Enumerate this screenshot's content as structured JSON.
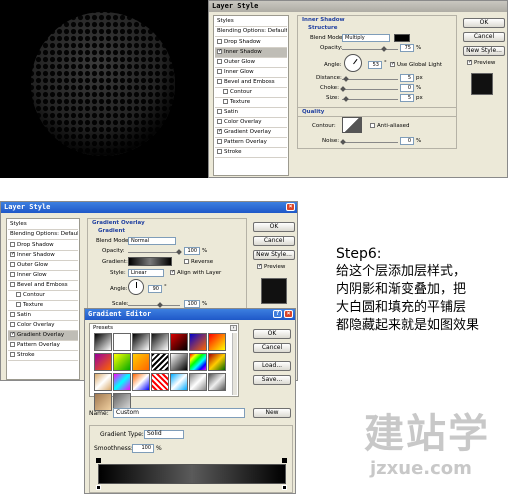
{
  "dialog1": {
    "title": "Layer Style",
    "styles_header": "Styles",
    "blending": "Blending Options: Default",
    "items": [
      "Drop Shadow",
      "Inner Shadow",
      "Outer Glow",
      "Inner Glow",
      "Bevel and Emboss",
      "Contour",
      "Texture",
      "Satin",
      "Color Overlay",
      "Gradient Overlay",
      "Pattern Overlay",
      "Stroke"
    ],
    "checked": [
      false,
      true,
      false,
      false,
      false,
      false,
      false,
      false,
      false,
      true,
      false,
      false
    ],
    "selected_index": 1,
    "group_title": "Inner Shadow",
    "structure": "Structure",
    "blend_mode_label": "Blend Mode:",
    "blend_mode_value": "Multiply",
    "opacity_label": "Opacity:",
    "opacity_value": "75",
    "angle_label": "Angle:",
    "angle_value": "53",
    "use_global_light": "Use Global Light",
    "distance_label": "Distance:",
    "distance_value": "5",
    "choke_label": "Choke:",
    "choke_value": "0",
    "size_label": "Size:",
    "size_value": "5",
    "unit_pct": "%",
    "unit_deg": "°",
    "unit_px": "px",
    "quality": "Quality",
    "contour_label": "Contour:",
    "anti_aliased": "Anti-aliased",
    "noise_label": "Noise:",
    "noise_value": "0",
    "ok": "OK",
    "cancel": "Cancel",
    "new_style": "New Style...",
    "preview": "Preview"
  },
  "dialog2": {
    "title": "Layer Style",
    "styles_header": "Styles",
    "blending": "Blending Options: Default",
    "items": [
      "Drop Shadow",
      "Inner Shadow",
      "Outer Glow",
      "Inner Glow",
      "Bevel and Emboss",
      "Contour",
      "Texture",
      "Satin",
      "Color Overlay",
      "Gradient Overlay",
      "Pattern Overlay",
      "Stroke"
    ],
    "checked": [
      false,
      true,
      false,
      false,
      false,
      false,
      false,
      false,
      false,
      true,
      false,
      false
    ],
    "selected_index": 9,
    "group_title": "Gradient Overlay",
    "gradient_sub": "Gradient",
    "blend_mode_label": "Blend Mode:",
    "blend_mode_value": "Normal",
    "opacity_label": "Opacity:",
    "opacity_value": "100",
    "gradient_label": "Gradient:",
    "reverse": "Reverse",
    "style_label": "Style:",
    "style_value": "Linear",
    "align_with_layer": "Align with Layer",
    "angle_label": "Angle:",
    "angle_value": "90",
    "scale_label": "Scale:",
    "scale_value": "100",
    "unit_pct": "%",
    "unit_deg": "°",
    "ok": "OK",
    "cancel": "Cancel",
    "new_style": "New Style...",
    "preview": "Preview"
  },
  "gradient_editor": {
    "title": "Gradient Editor",
    "presets": "Presets",
    "ok": "OK",
    "cancel": "Cancel",
    "load": "Load...",
    "save": "Save...",
    "name_label": "Name:",
    "name_value": "Custom",
    "new": "New",
    "gradient_type_label": "Gradient Type:",
    "gradient_type_value": "Solid",
    "smoothness_label": "Smoothness:",
    "smoothness_value": "100",
    "unit_pct": "%"
  },
  "caption": {
    "step": "Step6:",
    "lines": [
      "给这个层添加层样式，",
      "内阴影和渐变叠加，把",
      "大白圆和填充的平铺层",
      "都隐藏起来就是如图效果"
    ]
  },
  "watermark": {
    "cn": "建站学",
    "url": "jzxue.com"
  }
}
